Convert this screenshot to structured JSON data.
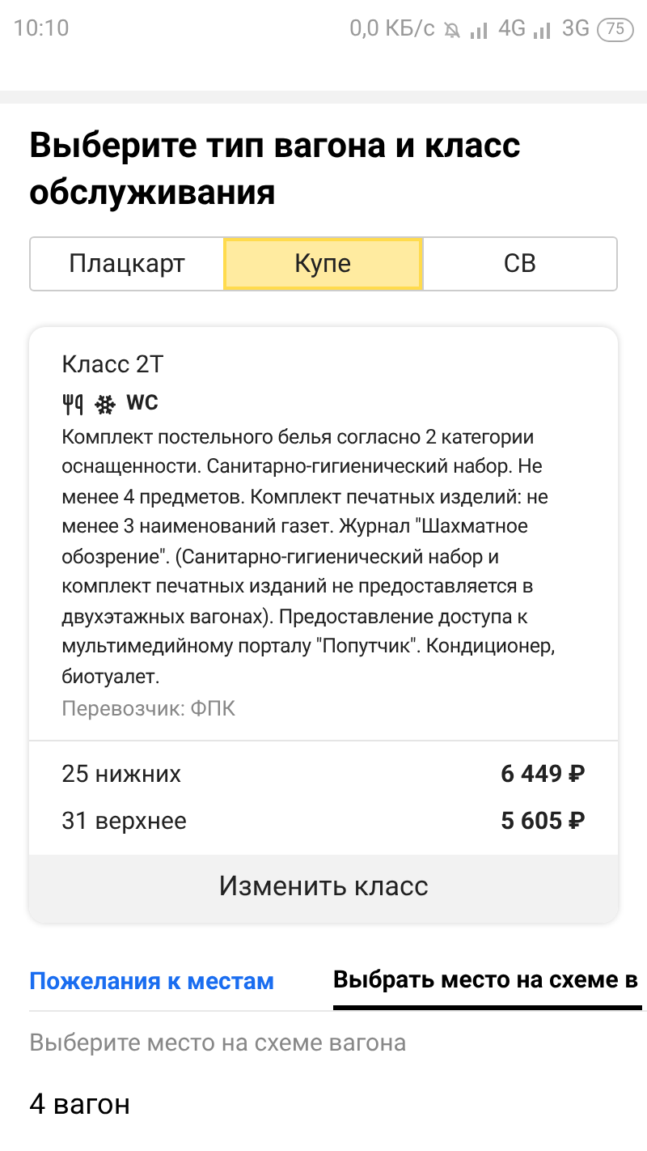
{
  "status_bar": {
    "time": "10:10",
    "network_speed": "0,0 КБ/с",
    "network_1": "4G",
    "network_2": "3G",
    "battery": "75"
  },
  "title": "Выберите тип вагона и класс обслуживания",
  "car_types": [
    {
      "label": "Плацкарт",
      "selected": false
    },
    {
      "label": "Купе",
      "selected": true
    },
    {
      "label": "СВ",
      "selected": false
    }
  ],
  "class_card": {
    "name": "Класс 2Т",
    "amenities": [
      {
        "kind": "food"
      },
      {
        "kind": "climate"
      },
      {
        "kind": "wc",
        "label": "WC"
      }
    ],
    "description": "Комплект постельного белья согласно 2 категории оснащенности. Санитарно-гигиенический набор. Не менее 4 предметов. Комплект печатных изделий: не менее 3 наименований газет. Журнал \"Шахматное обозрение\". (Санитарно-гигиенический набор и комплект печатных изданий не предоставляется в двухэтажных вагонах). Предоставление доступа к мультимедийному порталу \"Попутчик\". Кондиционер, биотуалет.",
    "carrier": "Перевозчик: ФПК",
    "seats": [
      {
        "label": "25 нижних",
        "price": "6 449 ₽"
      },
      {
        "label": "31 верхнее",
        "price": "5 605 ₽"
      }
    ],
    "button": "Изменить класс"
  },
  "seat_tabs": [
    {
      "label": "Пожелания к местам",
      "selected": false
    },
    {
      "label": "Выбрать место на схеме в",
      "selected": true
    }
  ],
  "hint": "Выберите место на схеме вагона",
  "car_number": "4 вагон"
}
